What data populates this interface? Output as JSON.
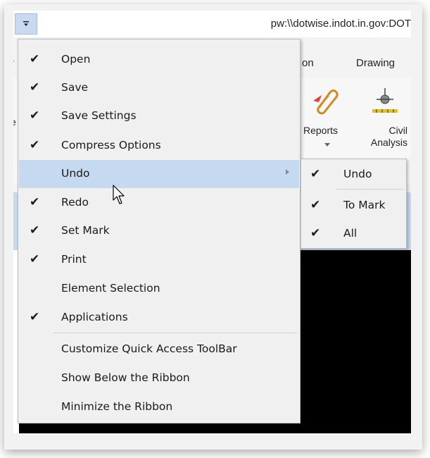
{
  "window": {
    "title": "pw:\\\\dotwise.indot.in.gov:DOT",
    "qat_button_glyph": "€"
  },
  "tabs": [
    "r",
    "on",
    "Drawing"
  ],
  "ribbon": {
    "left_edge_char": "e",
    "reports_label": "Reports",
    "civil_analysis_label": "Civil Analysis",
    "reports_icon": "paperclip-icon",
    "civil_icon": "survey-level-icon"
  },
  "menu": {
    "items": [
      {
        "label": "Open",
        "checked": true
      },
      {
        "label": "Save",
        "checked": true
      },
      {
        "label": "Save Settings",
        "checked": true
      },
      {
        "label": "Compress Options",
        "checked": true
      },
      {
        "label": "Undo",
        "checked": false,
        "has_submenu": true
      },
      {
        "label": "Redo",
        "checked": true
      },
      {
        "label": "Set Mark",
        "checked": true
      },
      {
        "label": "Print",
        "checked": true
      },
      {
        "label": "Element Selection",
        "checked": false
      },
      {
        "label": "Applications",
        "checked": true
      },
      {
        "label": "Customize Quick Access ToolBar",
        "checked": false
      },
      {
        "label": "Show Below the Ribbon",
        "checked": false
      },
      {
        "label": "Minimize the Ribbon",
        "checked": false
      }
    ],
    "check_glyph": "✔",
    "highlight_color": "#c5daf0"
  },
  "submenu": {
    "items": [
      {
        "label": "Undo",
        "checked": true
      },
      {
        "label": "To Mark",
        "checked": true
      },
      {
        "label": "All",
        "checked": true
      }
    ]
  },
  "colors": {
    "ribbon_strip": "#c6d9ee",
    "qat_button": "#c9daf0"
  }
}
